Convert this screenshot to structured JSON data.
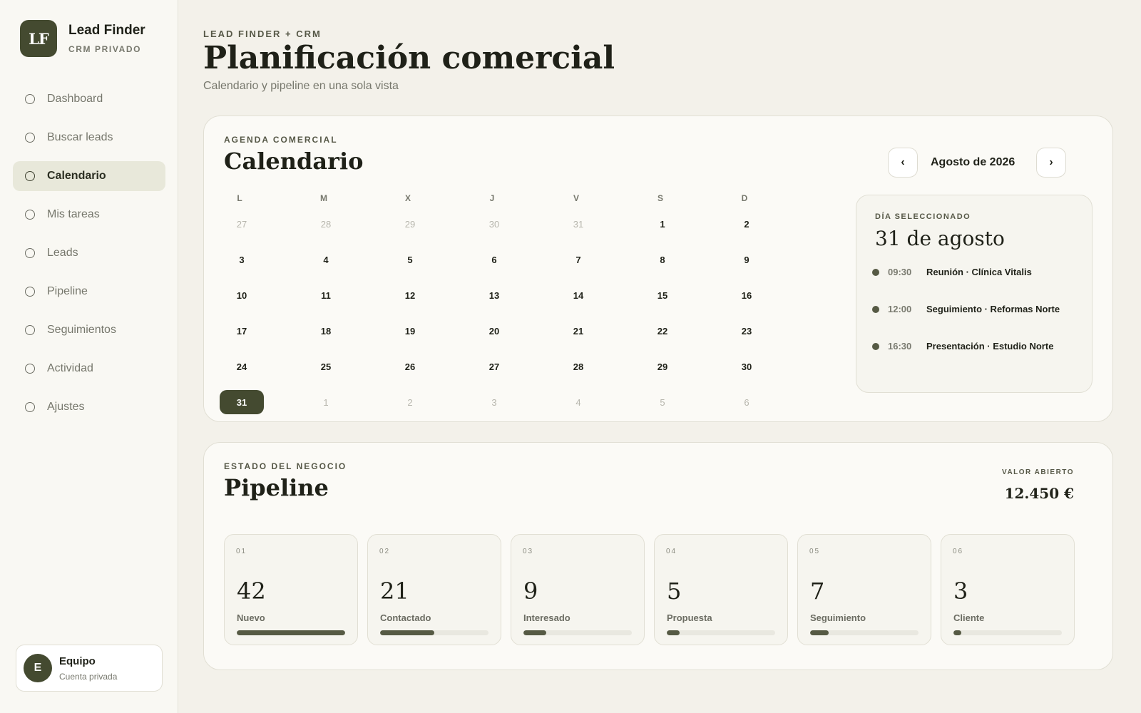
{
  "brand": {
    "logo": "LF",
    "title": "Lead Finder",
    "subtitle": "CRM PRIVADO"
  },
  "nav": [
    {
      "label": "Dashboard",
      "active": false
    },
    {
      "label": "Buscar leads",
      "active": false
    },
    {
      "label": "Calendario",
      "active": true
    },
    {
      "label": "Mis tareas",
      "active": false
    },
    {
      "label": "Leads",
      "active": false
    },
    {
      "label": "Pipeline",
      "active": false
    },
    {
      "label": "Seguimientos",
      "active": false
    },
    {
      "label": "Actividad",
      "active": false
    },
    {
      "label": "Ajustes",
      "active": false
    }
  ],
  "team": {
    "initial": "E",
    "name": "Equipo",
    "subtitle": "Cuenta privada"
  },
  "header": {
    "eyebrow": "LEAD FINDER + CRM",
    "title": "Planificación comercial",
    "subtitle": "Calendario y pipeline en una sola vista"
  },
  "calendar": {
    "eyebrow": "AGENDA COMERCIAL",
    "title": "Calendario",
    "month_label": "Agosto de 2026",
    "prev_label": "‹",
    "next_label": "›",
    "weekdays": [
      "L",
      "M",
      "X",
      "J",
      "V",
      "S",
      "D"
    ],
    "days": [
      {
        "n": "27",
        "muted": true
      },
      {
        "n": "28",
        "muted": true
      },
      {
        "n": "29",
        "muted": true
      },
      {
        "n": "30",
        "muted": true
      },
      {
        "n": "31",
        "muted": true
      },
      {
        "n": "1"
      },
      {
        "n": "2"
      },
      {
        "n": "3"
      },
      {
        "n": "4"
      },
      {
        "n": "5"
      },
      {
        "n": "6"
      },
      {
        "n": "7"
      },
      {
        "n": "8"
      },
      {
        "n": "9"
      },
      {
        "n": "10"
      },
      {
        "n": "11"
      },
      {
        "n": "12"
      },
      {
        "n": "13"
      },
      {
        "n": "14"
      },
      {
        "n": "15"
      },
      {
        "n": "16"
      },
      {
        "n": "17"
      },
      {
        "n": "18"
      },
      {
        "n": "19"
      },
      {
        "n": "20"
      },
      {
        "n": "21"
      },
      {
        "n": "22"
      },
      {
        "n": "23"
      },
      {
        "n": "24"
      },
      {
        "n": "25"
      },
      {
        "n": "26"
      },
      {
        "n": "27"
      },
      {
        "n": "28"
      },
      {
        "n": "29"
      },
      {
        "n": "30"
      },
      {
        "n": "31",
        "selected": true
      },
      {
        "n": "1",
        "muted": true
      },
      {
        "n": "2",
        "muted": true
      },
      {
        "n": "3",
        "muted": true
      },
      {
        "n": "4",
        "muted": true
      },
      {
        "n": "5",
        "muted": true
      },
      {
        "n": "6",
        "muted": true
      }
    ],
    "selected_day": {
      "eyebrow": "DÍA SELECCIONADO",
      "title": "31 de agosto",
      "events": [
        {
          "time": "09:30",
          "name": "Reunión · Clínica Vitalis"
        },
        {
          "time": "12:00",
          "name": "Seguimiento · Reformas Norte"
        },
        {
          "time": "16:30",
          "name": "Presentación · Estudio Norte"
        }
      ]
    }
  },
  "pipeline": {
    "eyebrow": "ESTADO DEL NEGOCIO",
    "title": "Pipeline",
    "open_value_label": "VALOR ABIERTO",
    "open_value": "12.450 €",
    "stages": [
      {
        "num": "01",
        "count": "42",
        "label": "Nuevo",
        "progress": 1.0
      },
      {
        "num": "02",
        "count": "21",
        "label": "Contactado",
        "progress": 0.5
      },
      {
        "num": "03",
        "count": "9",
        "label": "Interesado",
        "progress": 0.21
      },
      {
        "num": "04",
        "count": "5",
        "label": "Propuesta",
        "progress": 0.12
      },
      {
        "num": "05",
        "count": "7",
        "label": "Seguimiento",
        "progress": 0.17
      },
      {
        "num": "06",
        "count": "3",
        "label": "Cliente",
        "progress": 0.07
      }
    ]
  },
  "colors": {
    "accent": "#444a30",
    "background": "#f3f1ea",
    "card": "#fbfaf6",
    "muted_text": "#77786d"
  }
}
